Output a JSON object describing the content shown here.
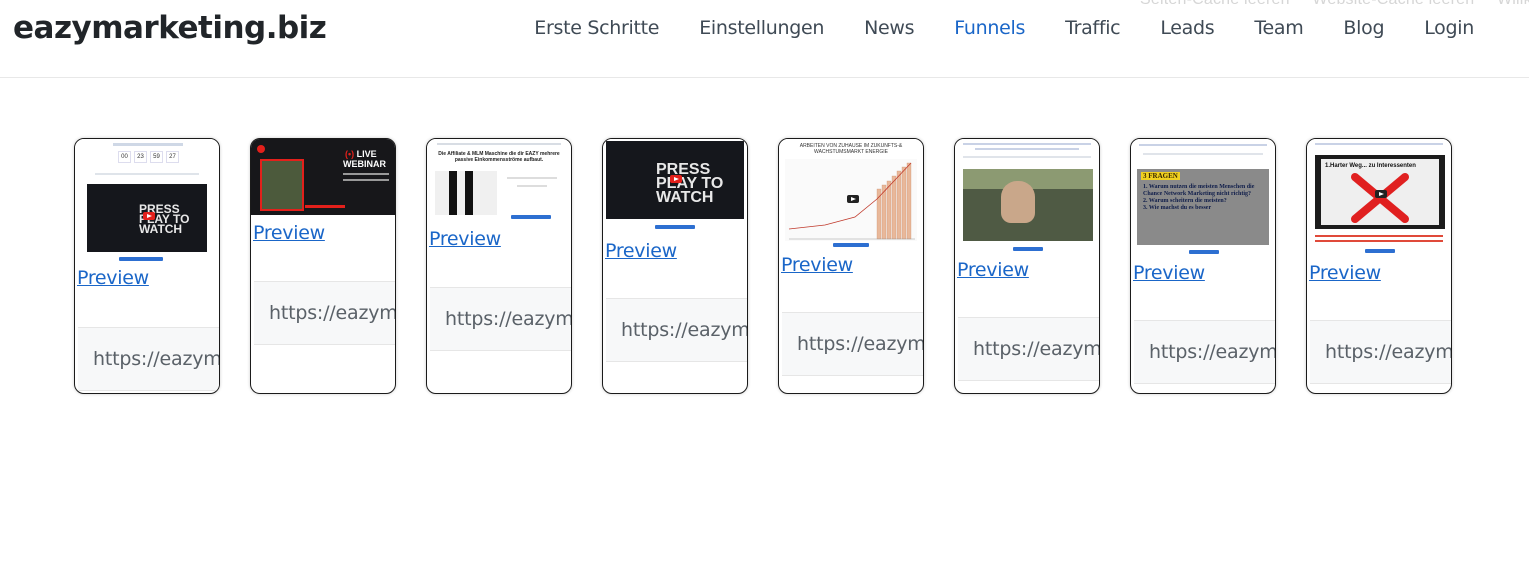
{
  "ghost_text": [
    "Seiten-Cache leeren",
    "Website-Cache leeren",
    "Willkommen"
  ],
  "brand": "eazymarketing.biz",
  "nav": [
    {
      "label": "Erste Schritte",
      "active": false
    },
    {
      "label": "Einstellungen",
      "active": false
    },
    {
      "label": "News",
      "active": false
    },
    {
      "label": "Funnels",
      "active": true
    },
    {
      "label": "Traffic",
      "active": false
    },
    {
      "label": "Leads",
      "active": false
    },
    {
      "label": "Team",
      "active": false
    },
    {
      "label": "Blog",
      "active": false
    },
    {
      "label": "Login",
      "active": false
    }
  ],
  "cards": [
    {
      "preview": "Preview",
      "url": "https://eazymarketing.biz",
      "countdown": [
        "00",
        "23",
        "59",
        "27"
      ],
      "video_text": "PRESS PLAY TO WATCH"
    },
    {
      "preview": "Preview",
      "url": "https://eazymarketing.biz",
      "live": "LIVE",
      "webinar": "WEBINAR"
    },
    {
      "preview": "Preview",
      "url": "https://eazymarketing.biz",
      "headline": "Die Affiliate & MLM Maschine die dir EAZY mehrere passive Einkommensströme aufbaut."
    },
    {
      "preview": "Preview",
      "url": "https://eazymarketing.biz",
      "video_text": "PRESS PLAY TO WATCH"
    },
    {
      "preview": "Preview",
      "url": "https://eazymarketing.biz",
      "headline": "ARBEITEN VON ZUHAUSE IM ZUKUNFTS-& WACHSTUMSMARKT ENERGIE"
    },
    {
      "preview": "Preview",
      "url": "https://eazymarketing.biz"
    },
    {
      "preview": "Preview",
      "url": "https://eazymarketing.biz",
      "fragen_title": "3 FRAGEN",
      "fragen": [
        "1. Warum nutzen die meisten Menschen die Chance Network Marketing nicht richtig?",
        "2. Warum scheitern die meisten?",
        "3. Wie machst du es besser"
      ]
    },
    {
      "preview": "Preview",
      "url": "https://eazymarketing.biz",
      "headline": "1.Harter Weg... zu Interessenten"
    }
  ],
  "colors": {
    "link": "#1a66c8",
    "text": "#212529",
    "nav": "#3f4a55"
  }
}
